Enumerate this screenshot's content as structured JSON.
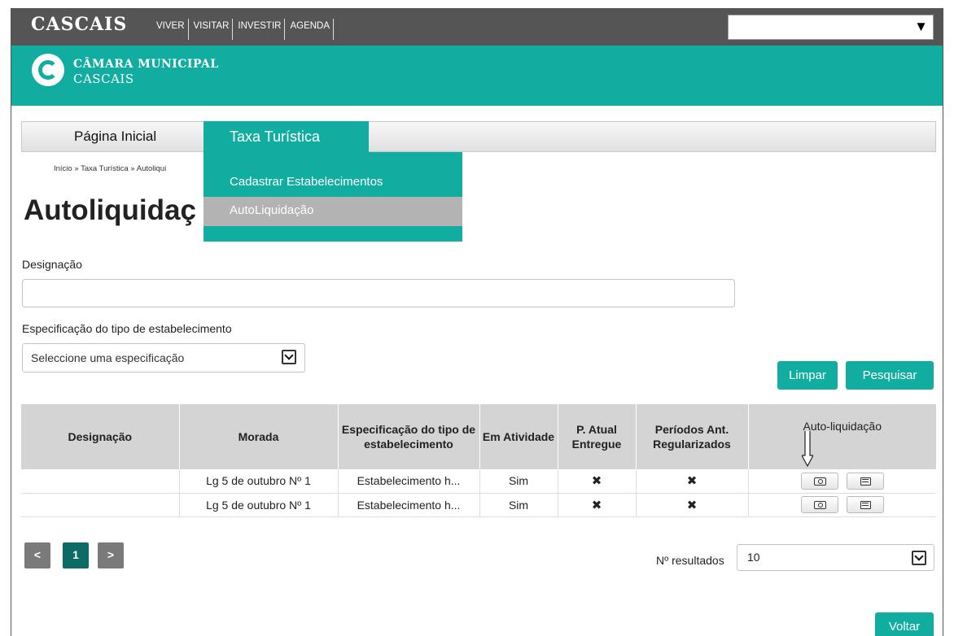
{
  "topbar": {
    "brand": "CASCAIS",
    "nav": [
      "VIVER",
      "VISITAR",
      "INVESTIR",
      "AGENDA"
    ]
  },
  "header": {
    "title": "CÂMARA MUNICIPAL",
    "subtitle": "CASCAIS"
  },
  "menu": {
    "home": "Página Inicial",
    "taxa": "Taxa Turística",
    "dropdown": [
      "Cadastrar Estabelecimentos",
      "AutoLiquidação"
    ]
  },
  "breadcrumb": "Início » Taxa Turística » Autoliqui",
  "page_title": "Autoliquidaç",
  "form": {
    "designacao_label": "Designação",
    "designacao_value": "",
    "espec_label": "Especificação do tipo de estabelecimento",
    "espec_selected": "Seleccione uma especificação",
    "limpar": "Limpar",
    "pesquisar": "Pesquisar"
  },
  "table": {
    "headers": [
      "Designação",
      "Morada",
      "Especificação do tipo de estabelecimento",
      "Em Atividade",
      "P. Atual Entregue",
      "Períodos Ant. Regularizados",
      "Auto-liquidação"
    ],
    "rows": [
      {
        "designacao": "",
        "morada": "Lg 5 de outubro Nº 1",
        "espec": "Estabelecimento h...",
        "atividade": "Sim",
        "atual": "✖",
        "anteriores": "✖"
      },
      {
        "designacao": "",
        "morada": "Lg 5 de outubro Nº 1",
        "espec": "Estabelecimento h...",
        "atividade": "Sim",
        "atual": "✖",
        "anteriores": "✖"
      }
    ]
  },
  "pagination": {
    "prev": "<",
    "current": "1",
    "next": ">",
    "results_label": "Nº resultados",
    "results_value": "10"
  },
  "voltar": "Voltar",
  "colors": {
    "accent": "#10ada0",
    "topbar": "#555555",
    "page_active": "#0d6b65"
  }
}
